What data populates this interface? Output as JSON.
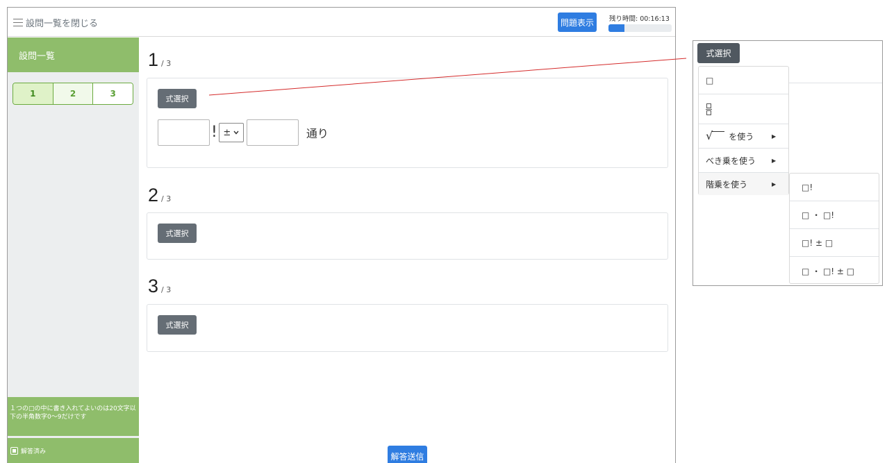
{
  "topbar": {
    "close_list_label": "設問一覧を閉じる",
    "show_question_label": "問題表示",
    "time_remaining_label": "残り時間: 00:16:13",
    "time_progress_fraction": 0.25
  },
  "sidebar": {
    "title": "設問一覧",
    "questions": [
      "1",
      "2",
      "3"
    ],
    "active_question": "1",
    "note": "１つの□の中に書き入れてよいのは20文字以下の半角数字0～9だけです",
    "answered_legend": "解答済み"
  },
  "questions": [
    {
      "number": "1",
      "total": "/ 3",
      "form_select_label": "式選択",
      "answer": {
        "factorial_mark": "!",
        "operator_value": "±",
        "unit_text": "通り"
      }
    },
    {
      "number": "2",
      "total": "/ 3",
      "form_select_label": "式選択"
    },
    {
      "number": "3",
      "total": "/ 3",
      "form_select_label": "式選択"
    }
  ],
  "submit_label": "解答送信",
  "callout": {
    "button_label": "式選択",
    "menu": [
      {
        "label": "□",
        "kind": "box"
      },
      {
        "label": "",
        "kind": "fraction"
      },
      {
        "label": "を使う",
        "kind": "sqrt",
        "has_submenu": true
      },
      {
        "label": "べき乗を使う",
        "kind": "text",
        "has_submenu": true
      },
      {
        "label": "階乗を使う",
        "kind": "text",
        "has_submenu": true,
        "highlighted": true
      }
    ],
    "submenu": [
      "□!",
      "□ ・ □!",
      "□! ± □",
      "□ ・ □! ± □"
    ]
  },
  "colors": {
    "primary_blue": "#2f7de1",
    "sidebar_green": "#8fbd6b",
    "dark_button": "#656d75",
    "callout_line": "#d42a2a"
  }
}
